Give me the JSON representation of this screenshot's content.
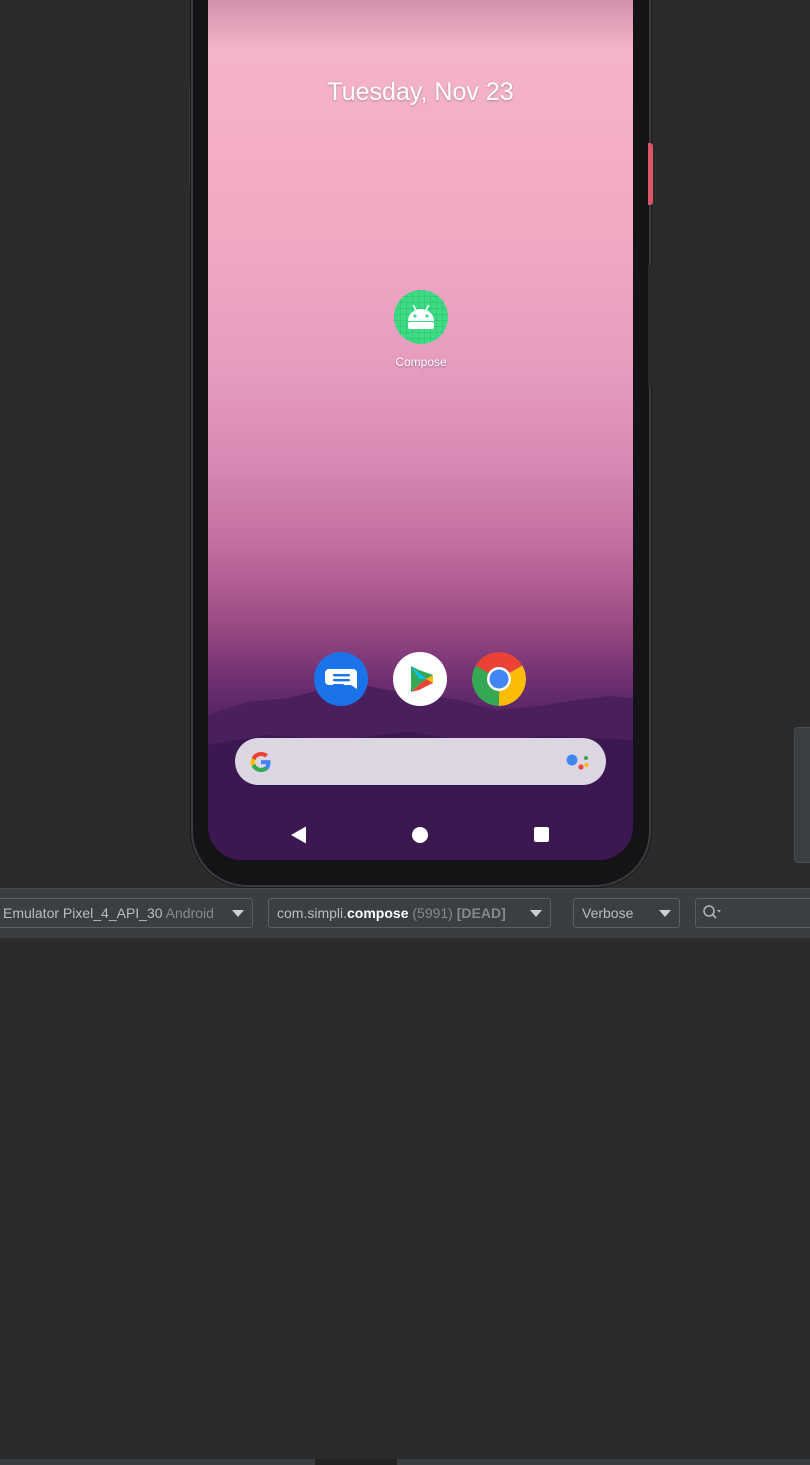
{
  "phone": {
    "date": "Tuesday, Nov 23",
    "home_apps": [
      {
        "label": "Compose",
        "icon": "android-app-icon",
        "color": "#3ddc84"
      }
    ],
    "dock": [
      {
        "name": "Messages",
        "icon": "messages-icon",
        "color": "#1a73e8"
      },
      {
        "name": "Play Store",
        "icon": "play-store-icon",
        "color": "#ffffff"
      },
      {
        "name": "Chrome",
        "icon": "chrome-icon",
        "color": "#4285f4"
      }
    ],
    "search_bar": {
      "icons": [
        "google-g-icon",
        "assistant-icon"
      ]
    },
    "nav_bar": [
      "back-icon",
      "home-icon",
      "recents-icon"
    ]
  },
  "logcat": {
    "device": {
      "name": "Emulator Pixel_4_API_30",
      "suffix": "Android"
    },
    "process": {
      "prefix": "com.simpli.",
      "bold": "compose",
      "pid": "(5991)",
      "status": "[DEAD]"
    },
    "log_level": "Verbose",
    "search": {
      "value": "",
      "placeholder": ""
    }
  },
  "colors": {
    "ide_background": "#2b2b2c",
    "toolbar_background": "#3b3e40",
    "power_button": "#d9566a"
  }
}
